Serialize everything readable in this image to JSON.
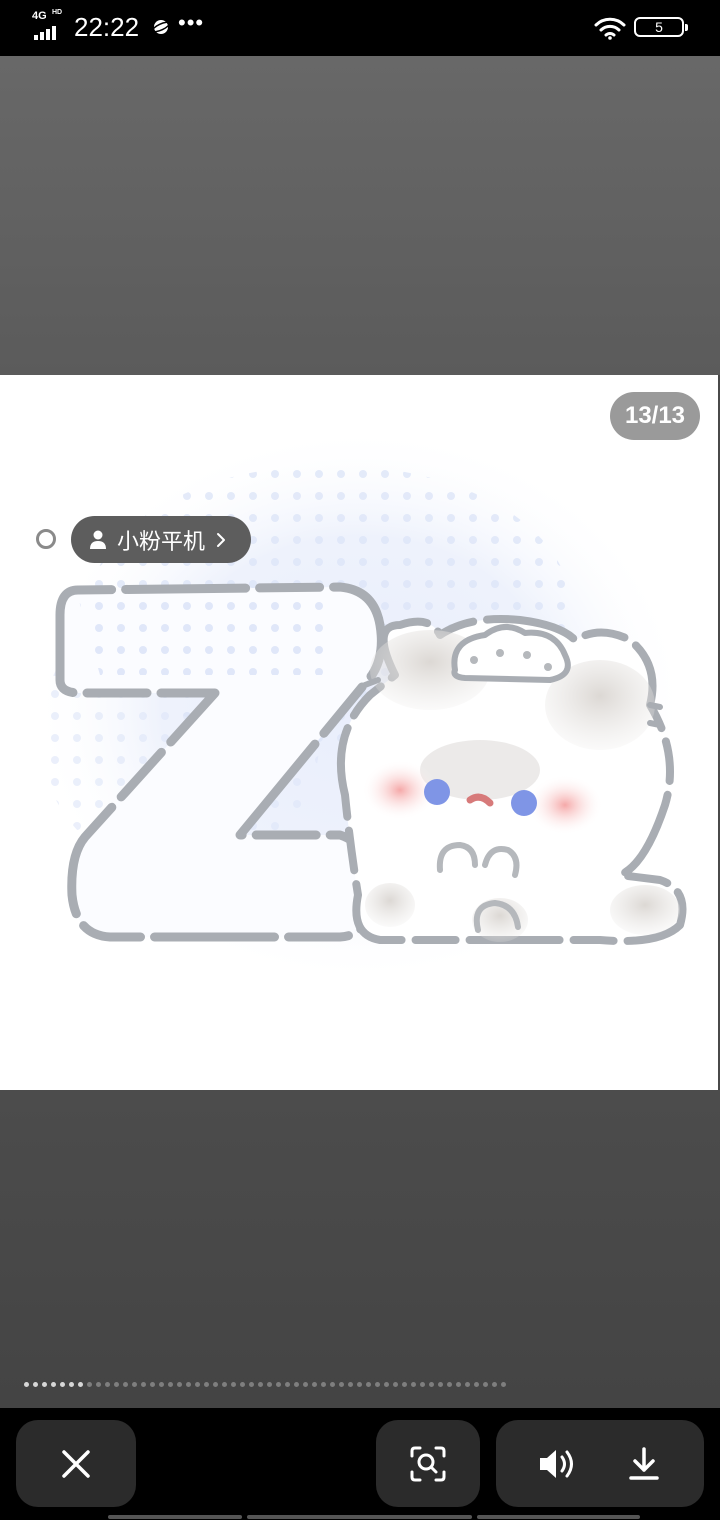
{
  "status_bar": {
    "network": "4G",
    "network_sup": "HD",
    "time": "22:22",
    "battery_level": "5"
  },
  "viewer": {
    "page_counter": "13/13",
    "tag_label": "小粉平机",
    "pager": {
      "total": 54,
      "active_index": [
        0,
        1,
        2,
        3,
        4,
        5,
        6
      ]
    }
  },
  "toolbar": {
    "close_icon": "close-icon",
    "scan_icon": "image-search-icon",
    "sound_icon": "speaker-icon",
    "download_icon": "download-icon"
  },
  "colors": {
    "tag_pill": "#5d5d5d",
    "counter_pill": "#9a9a9a",
    "toolbar_bg": "#000000",
    "button_bg": "#2b2b2b"
  }
}
